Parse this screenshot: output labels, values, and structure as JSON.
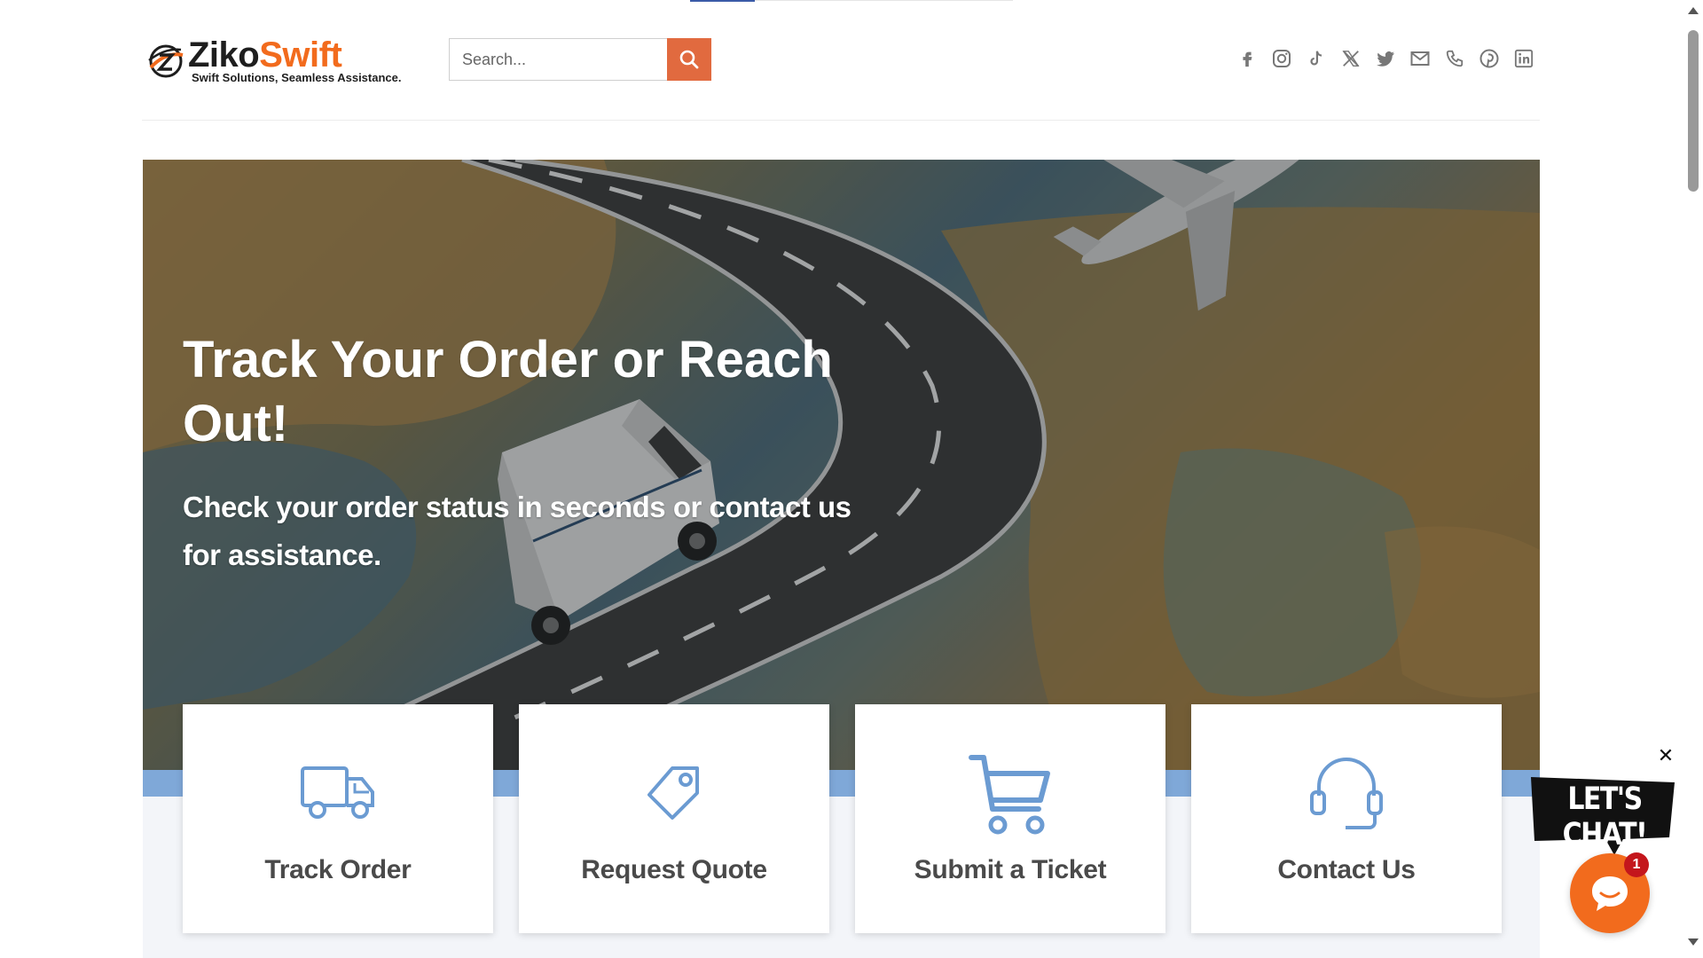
{
  "header": {
    "logo": {
      "name_part1": "Ziko",
      "name_part2": "Swift",
      "tagline": "Swift Solutions, Seamless Assistance."
    },
    "search": {
      "placeholder": "Search...",
      "button_icon": "search-icon"
    },
    "social_icons": [
      "facebook-icon",
      "instagram-icon",
      "tiktok-icon",
      "x-icon",
      "twitter-icon",
      "email-icon",
      "phone-icon",
      "pinterest-icon",
      "linkedin-icon"
    ]
  },
  "hero": {
    "title": "Track Your Order or Reach Out!",
    "subtitle": "Check your order status in seconds or contact us for assistance."
  },
  "cards": [
    {
      "label": "Track Order",
      "icon": "truck-icon"
    },
    {
      "label": "Request Quote",
      "icon": "tag-icon"
    },
    {
      "label": "Submit a Ticket",
      "icon": "cart-icon"
    },
    {
      "label": "Contact Us",
      "icon": "headset-icon"
    }
  ],
  "chat": {
    "bubble_text": "LET'S CHAT!",
    "badge_count": "1",
    "close_icon": "close-icon"
  },
  "colors": {
    "brand_orange": "#f26b1d",
    "search_button": "#e16a3f",
    "icon_blue": "#6b9bd2",
    "band_blue": "#7fa8d8",
    "badge_red": "#c4161c"
  }
}
